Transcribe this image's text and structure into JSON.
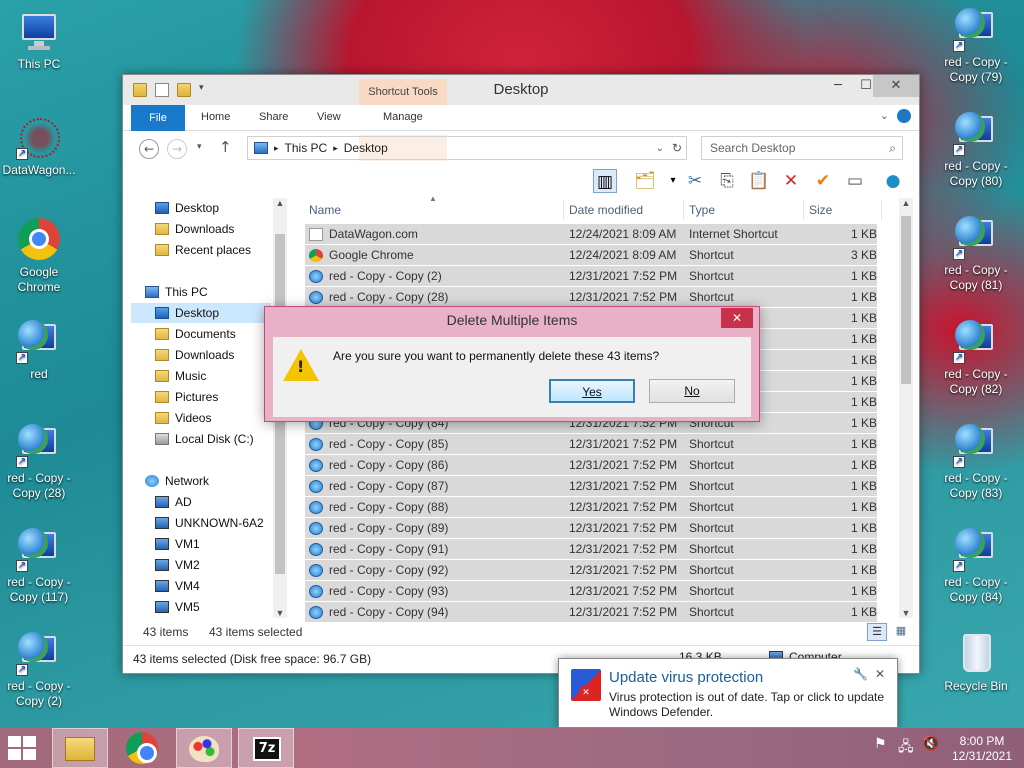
{
  "desktop": {
    "left_icons": [
      {
        "label": "This PC"
      },
      {
        "label": "DataWagon..."
      },
      {
        "label": "Google Chrome"
      },
      {
        "label": "red"
      },
      {
        "label": "red - Copy - Copy (28)"
      },
      {
        "label": "red - Copy - Copy (117)"
      },
      {
        "label": "red - Copy - Copy (2)"
      }
    ],
    "right_icons": [
      {
        "label": "red - Copy - Copy (79)"
      },
      {
        "label": "red - Copy - Copy (80)"
      },
      {
        "label": "red - Copy - Copy (81)"
      },
      {
        "label": "red - Copy - Copy (82)"
      },
      {
        "label": "red - Copy - Copy (83)"
      },
      {
        "label": "red - Copy - Copy (84)"
      },
      {
        "label": "Recycle Bin"
      }
    ]
  },
  "explorer": {
    "title": "Desktop",
    "tabs": {
      "file": "File",
      "home": "Home",
      "share": "Share",
      "view": "View",
      "contextual_group": "Shortcut Tools",
      "manage": "Manage"
    },
    "address": {
      "segment1": "This PC",
      "segment2": "Desktop"
    },
    "search_placeholder": "Search Desktop",
    "nav": {
      "favorites": [
        "Desktop",
        "Downloads",
        "Recent places"
      ],
      "this_pc": "This PC",
      "pc_items": [
        "Desktop",
        "Documents",
        "Downloads",
        "Music",
        "Pictures",
        "Videos",
        "Local Disk (C:)"
      ],
      "network": "Network",
      "net_items": [
        "AD",
        "UNKNOWN-6A2",
        "VM1",
        "VM2",
        "VM4",
        "VM5"
      ]
    },
    "columns": {
      "name": "Name",
      "date": "Date modified",
      "type": "Type",
      "size": "Size"
    },
    "files": [
      {
        "name": "DataWagon.com",
        "date": "12/24/2021 8:09 AM",
        "type": "Internet Shortcut",
        "size": "1 KB",
        "icon": "url-icon"
      },
      {
        "name": "Google Chrome",
        "date": "12/24/2021 8:09 AM",
        "type": "Shortcut",
        "size": "3 KB",
        "icon": "chrome-icon"
      },
      {
        "name": "red - Copy - Copy (2)",
        "date": "12/31/2021 7:52 PM",
        "type": "Shortcut",
        "size": "1 KB",
        "icon": "globe-icon"
      },
      {
        "name": "red - Copy - Copy (28)",
        "date": "12/31/2021 7:52 PM",
        "type": "Shortcut",
        "size": "1 KB",
        "icon": "globe-icon"
      },
      {
        "name": "",
        "date": "",
        "type": "",
        "size": "1 KB",
        "icon": "globe-icon"
      },
      {
        "name": "",
        "date": "",
        "type": "",
        "size": "1 KB",
        "icon": "globe-icon"
      },
      {
        "name": "",
        "date": "",
        "type": "",
        "size": "1 KB",
        "icon": "globe-icon"
      },
      {
        "name": "",
        "date": "",
        "type": "",
        "size": "1 KB",
        "icon": "globe-icon"
      },
      {
        "name": "",
        "date": "",
        "type": "",
        "size": "1 KB",
        "icon": "globe-icon"
      },
      {
        "name": "red - Copy - Copy (84)",
        "date": "12/31/2021 7:52 PM",
        "type": "Shortcut",
        "size": "1 KB",
        "icon": "globe-icon"
      },
      {
        "name": "red - Copy - Copy (85)",
        "date": "12/31/2021 7:52 PM",
        "type": "Shortcut",
        "size": "1 KB",
        "icon": "globe-icon"
      },
      {
        "name": "red - Copy - Copy (86)",
        "date": "12/31/2021 7:52 PM",
        "type": "Shortcut",
        "size": "1 KB",
        "icon": "globe-icon"
      },
      {
        "name": "red - Copy - Copy (87)",
        "date": "12/31/2021 7:52 PM",
        "type": "Shortcut",
        "size": "1 KB",
        "icon": "globe-icon"
      },
      {
        "name": "red - Copy - Copy (88)",
        "date": "12/31/2021 7:52 PM",
        "type": "Shortcut",
        "size": "1 KB",
        "icon": "globe-icon"
      },
      {
        "name": "red - Copy - Copy (89)",
        "date": "12/31/2021 7:52 PM",
        "type": "Shortcut",
        "size": "1 KB",
        "icon": "globe-icon"
      },
      {
        "name": "red - Copy - Copy (91)",
        "date": "12/31/2021 7:52 PM",
        "type": "Shortcut",
        "size": "1 KB",
        "icon": "globe-icon"
      },
      {
        "name": "red - Copy - Copy (92)",
        "date": "12/31/2021 7:52 PM",
        "type": "Shortcut",
        "size": "1 KB",
        "icon": "globe-icon"
      },
      {
        "name": "red - Copy - Copy (93)",
        "date": "12/31/2021 7:52 PM",
        "type": "Shortcut",
        "size": "1 KB",
        "icon": "globe-icon"
      },
      {
        "name": "red - Copy - Copy (94)",
        "date": "12/31/2021 7:52 PM",
        "type": "Shortcut",
        "size": "1 KB",
        "icon": "globe-icon"
      }
    ],
    "item_count": "43 items",
    "selected_count": "43 items selected",
    "status": "43 items selected (Disk free space: 96.7 GB)",
    "status_size": "16.3 KB",
    "status_location": "Computer"
  },
  "dialog": {
    "title": "Delete Multiple Items",
    "message": "Are you sure you want to permanently delete these 43 items?",
    "yes": "Yes",
    "no": "No",
    "close": "✕"
  },
  "toast": {
    "title": "Update virus protection",
    "text": "Virus protection is out of date. Tap or click to update Windows Defender."
  },
  "taskbar": {
    "apps": [
      "file-explorer",
      "google-chrome",
      "paint",
      "7-zip"
    ],
    "seven_zip_label": "7z",
    "time": "8:00 PM",
    "date": "12/31/2021"
  }
}
